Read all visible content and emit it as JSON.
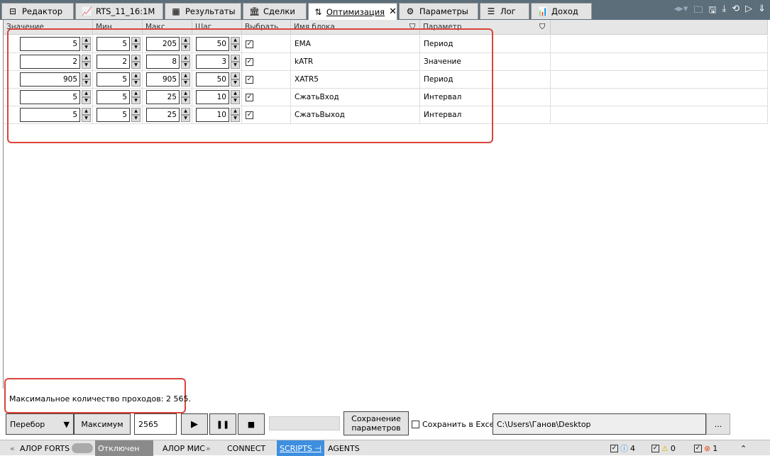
{
  "tabs": [
    {
      "label": "Редактор",
      "icon": "editor-icon"
    },
    {
      "label": "RTS_11_16:1M",
      "icon": "chart-icon"
    },
    {
      "label": "Результаты",
      "icon": "results-icon"
    },
    {
      "label": "Сделки",
      "icon": "bank-icon"
    },
    {
      "label": "Оптимизация",
      "icon": "sliders-icon",
      "active": true
    },
    {
      "label": "Параметры",
      "icon": "gear-icon"
    },
    {
      "label": "Лог",
      "icon": "list-icon"
    },
    {
      "label": "Доход",
      "icon": "income-chart-icon"
    }
  ],
  "columns": [
    "Значение",
    "Мин",
    "Макс",
    "Шаг",
    "Выбрать",
    "Имя блока",
    "Параметр"
  ],
  "rows": [
    {
      "value": "5",
      "min": "5",
      "max": "205",
      "step": "50",
      "selected": true,
      "block": "EMA",
      "param": "Период"
    },
    {
      "value": "2",
      "min": "2",
      "max": "8",
      "step": "3",
      "selected": true,
      "block": "kATR",
      "param": "Значение"
    },
    {
      "value": "905",
      "min": "5",
      "max": "905",
      "step": "50",
      "selected": true,
      "block": "XATR5",
      "param": "Период"
    },
    {
      "value": "5",
      "min": "5",
      "max": "25",
      "step": "10",
      "selected": true,
      "block": "СжатьВход",
      "param": "Интервал"
    },
    {
      "value": "5",
      "min": "5",
      "max": "25",
      "step": "10",
      "selected": true,
      "block": "СжатьВыход",
      "param": "Интервал"
    }
  ],
  "message": "Максимальное количество проходов: 2 565.",
  "controls": {
    "mode": "Перебор",
    "max_button": "Максимум",
    "passes": "2565",
    "save_params_1": "Сохранение",
    "save_params_2": "параметров",
    "save_excel": "Сохранить в Excel",
    "path": "C:\\Users\\Ганов\\Desktop",
    "browse": "..."
  },
  "status": {
    "conn1": "АЛОР FORTS",
    "conn1_state": "Отключен",
    "conn2": "АЛОР МИС",
    "tabs": [
      "CONNECT",
      "SCRIPTS",
      "AGENTS"
    ],
    "info_count": "4",
    "warn_count": "0",
    "error_count": "1"
  }
}
